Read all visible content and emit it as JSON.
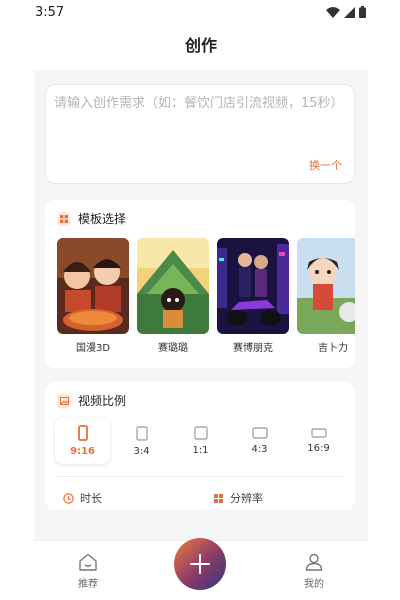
{
  "status_bar": {
    "time": "3:57"
  },
  "header": {
    "title": "创作"
  },
  "prompt": {
    "placeholder": "请输入创作需求（如：餐饮门店引流视频，15秒）",
    "switch_label": "换一个"
  },
  "templates": {
    "section_title": "模板选择",
    "items": [
      {
        "label": "国漫3D",
        "image": "couple-hotpot-3d"
      },
      {
        "label": "赛璐璐",
        "image": "cel-shaded-character"
      },
      {
        "label": "赛博朋克",
        "image": "cyberpunk-couple-motorcycle"
      },
      {
        "label": "吉卜力",
        "image": "ghibli-style-girl"
      }
    ]
  },
  "ratio": {
    "section_title": "视频比例",
    "selected": "9:16",
    "options": [
      {
        "label": "9:16"
      },
      {
        "label": "3:4"
      },
      {
        "label": "1:1"
      },
      {
        "label": "4:3"
      },
      {
        "label": "16:9"
      }
    ],
    "duration_label": "时长",
    "resolution_label": "分辨率"
  },
  "bottom_nav": {
    "items": [
      {
        "label": "推荐",
        "icon": "home-icon"
      },
      {
        "label": "",
        "icon": "plus-icon"
      },
      {
        "label": "我的",
        "icon": "user-icon"
      }
    ]
  },
  "colors": {
    "accent": "#e5713b"
  }
}
